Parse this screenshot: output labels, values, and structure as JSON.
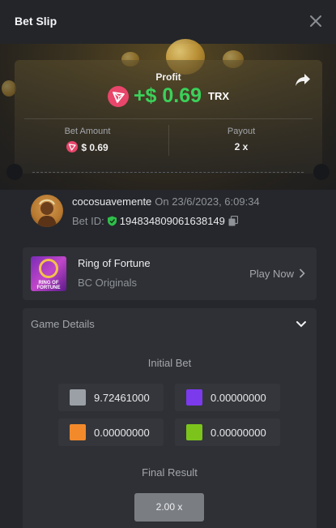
{
  "header": {
    "title": "Bet Slip"
  },
  "profit": {
    "label": "Profit",
    "value": "+$ 0.69",
    "currency": "TRX",
    "currency_color": "#e8466b",
    "value_color": "#3bd15a"
  },
  "bet_amount": {
    "label": "Bet Amount",
    "value": "$ 0.69"
  },
  "payout": {
    "label": "Payout",
    "value": "2 x"
  },
  "user": {
    "username": "cocosuavemente",
    "date_text": "On 23/6/2023, 6:09:34",
    "bet_id_label": "Bet ID:",
    "bet_id": "194834809061638149"
  },
  "game": {
    "name": "Ring of Fortune",
    "provider": "BC Originals",
    "play_label": "Play Now",
    "thumb_caption": "RING OF FORTUNE"
  },
  "details": {
    "title": "Game Details",
    "initial_bet_label": "Initial Bet",
    "bets": [
      {
        "color": "#9aa0a6",
        "value": "9.72461000"
      },
      {
        "color": "#7c3aed",
        "value": "0.00000000"
      },
      {
        "color": "#f28a2b",
        "value": "0.00000000"
      },
      {
        "color": "#7cc41c",
        "value": "0.00000000"
      }
    ],
    "final_result_label": "Final Result",
    "final_result": "2.00 x"
  }
}
